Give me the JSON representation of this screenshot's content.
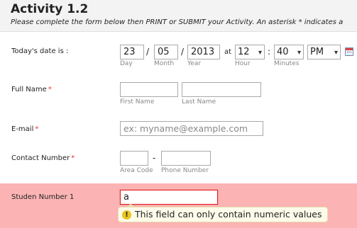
{
  "header": {
    "title": "Activity 1.2",
    "subtitle": "Please complete the form below then PRINT or SUBMIT your Activity. An asterisk * indicates a"
  },
  "date": {
    "label": "Today's date is :",
    "day": "23",
    "month": "05",
    "year": "2013",
    "at": "at",
    "hour": "12",
    "minute": "40",
    "ampm": "PM",
    "sep_slash": "/",
    "sep_colon": ":",
    "sub_day": "Day",
    "sub_month": "Month",
    "sub_year": "Year",
    "sub_hour": "Hour",
    "sub_minute": "Minutes"
  },
  "full_name": {
    "label": "Full Name",
    "required": "*",
    "first_value": "",
    "last_value": "",
    "sub_first": "First Name",
    "sub_last": "Last Name"
  },
  "email": {
    "label": "E-mail",
    "required": "*",
    "placeholder": "ex: myname@example.com"
  },
  "contact": {
    "label": "Contact Number",
    "required": "*",
    "area_value": "",
    "dash": "-",
    "phone_value": "",
    "sub_area": "Area Code",
    "sub_phone": "Phone Number"
  },
  "student": {
    "label": "Studen Number 1",
    "value": "a",
    "error": "This field can only contain numeric values"
  },
  "icons": {
    "calendar": "calendar-icon",
    "dropdown": "chevron-down-icon",
    "warning": "warning-icon"
  },
  "colors": {
    "error_bg": "#fbb3b3",
    "error_border": "#e02020",
    "required": "#e33333",
    "tooltip_bg": "#fdfbe9",
    "warning": "#e9c41d"
  }
}
